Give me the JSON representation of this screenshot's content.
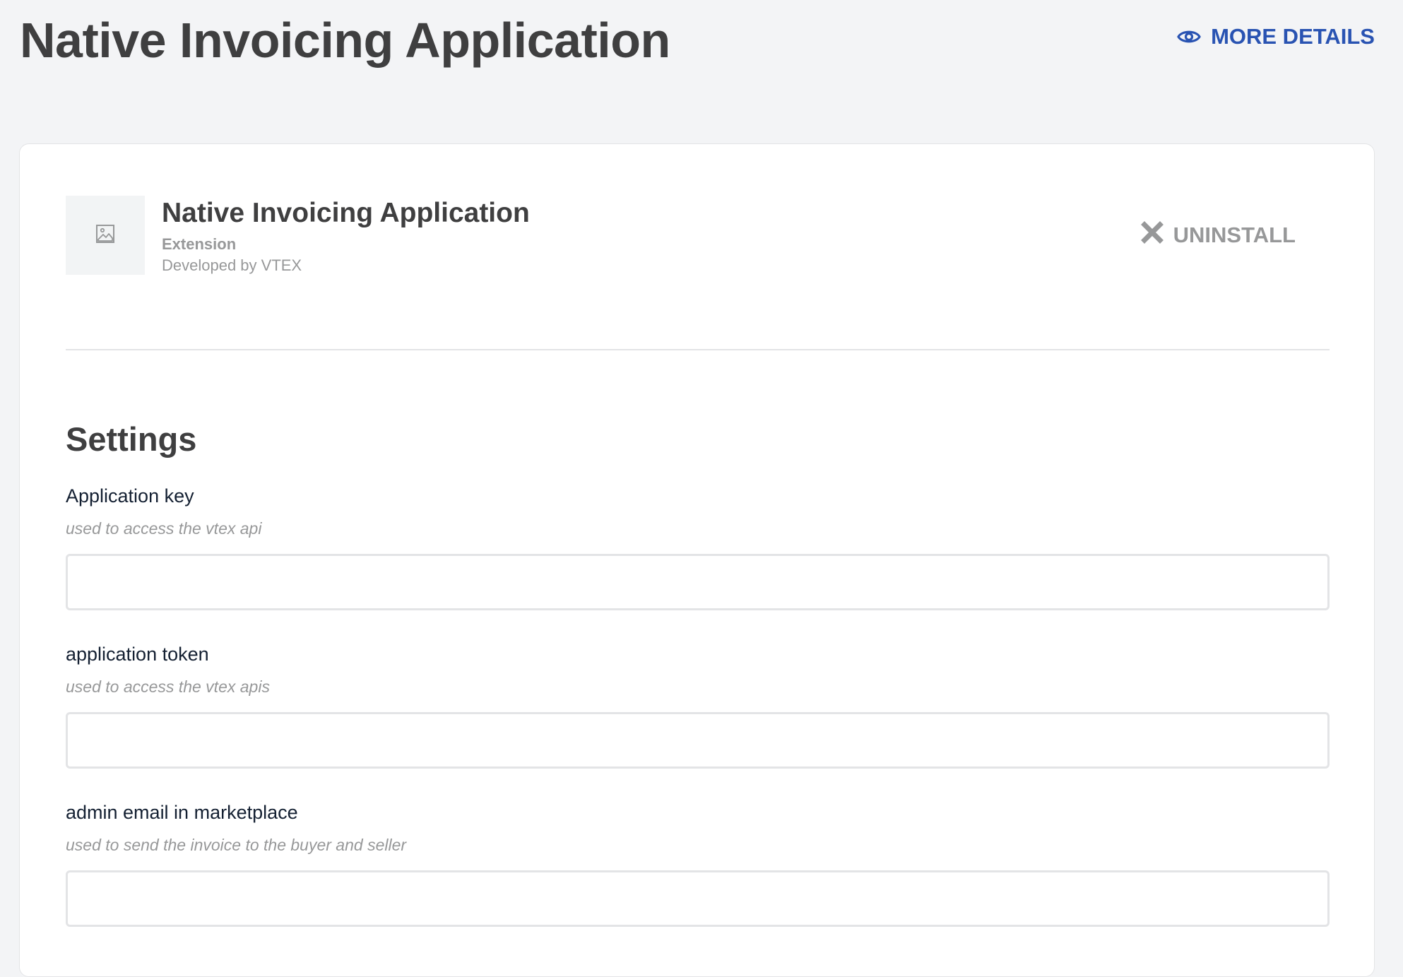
{
  "header": {
    "title": "Native Invoicing Application",
    "more_details_label": "MORE DETAILS",
    "more_details_icon": "eye-icon",
    "accent_color": "#2953b2"
  },
  "app": {
    "name": "Native Invoicing Application",
    "type": "Extension",
    "developer": "Developed by VTEX",
    "thumbnail_icon": "image-placeholder-icon",
    "uninstall_label": "UNINSTALL",
    "uninstall_icon": "close-icon"
  },
  "settings": {
    "title": "Settings",
    "fields": [
      {
        "label": "Application key",
        "help": "used to access the vtex api",
        "value": ""
      },
      {
        "label": "application token",
        "help": "used to access the vtex apis",
        "value": ""
      },
      {
        "label": "admin email in marketplace",
        "help": "used to send the invoice to the buyer and seller",
        "value": ""
      }
    ]
  }
}
